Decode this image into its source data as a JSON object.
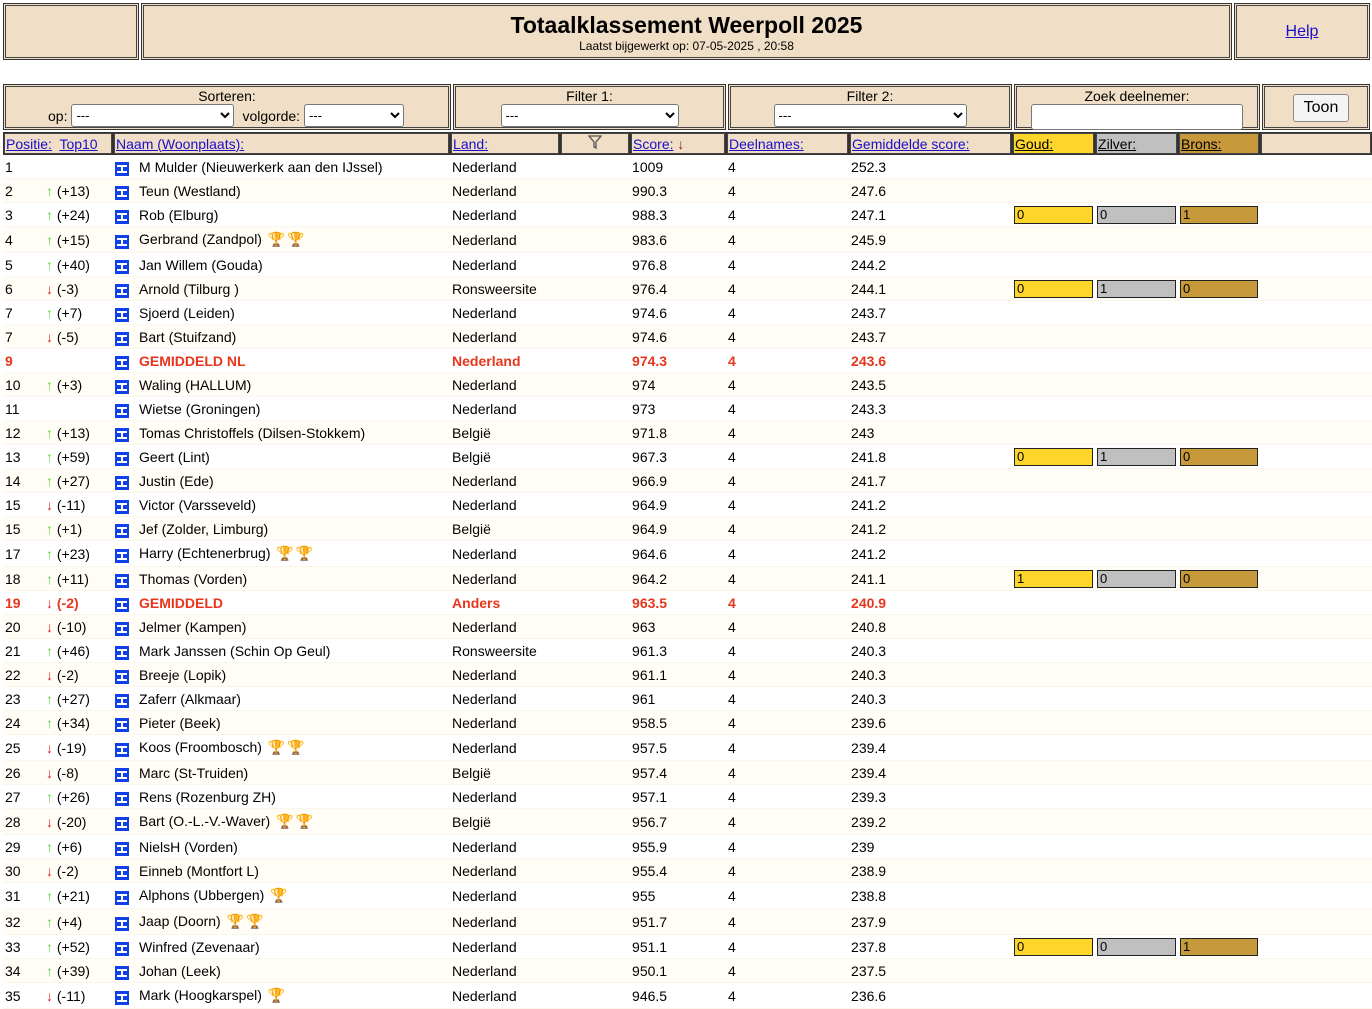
{
  "header": {
    "title": "Totaalklassement Weerpoll 2025",
    "updated": "Laatst bijgewerkt op: 07-05-2025 , 20:58",
    "help": "Help"
  },
  "controls": {
    "sort_label": "Sorteren:",
    "op_label": "op:",
    "op_value": "---",
    "order_label": "volgorde:",
    "order_value": "---",
    "filter1_label": "Filter 1:",
    "filter1_value": "---",
    "filter2_label": "Filter 2:",
    "filter2_value": "---",
    "search_label": "Zoek deelnemer:",
    "search_value": "",
    "show_button": "Toon"
  },
  "columns": {
    "position": "Positie:",
    "top10": "Top10",
    "name": "Naam (Woonplaats):",
    "land": "Land:",
    "score": "Score:",
    "entries": "Deelnames:",
    "avg": "Gemiddelde score:",
    "gold": "Goud:",
    "silver": "Zilver:",
    "bronze": "Brons:"
  },
  "colors": {
    "gold": "#fdd52b",
    "silver": "#c0c0c0",
    "bronze": "#c6993a",
    "highlight": "#e8351b",
    "header_bg": "#f0dfc6"
  },
  "rows": [
    {
      "pos": "1",
      "dir": "",
      "delta": "",
      "name": "M Mulder (Nieuwerkerk aan den IJssel)",
      "land": "Nederland",
      "score": "1009",
      "entries": "4",
      "avg": "252.3"
    },
    {
      "pos": "2",
      "dir": "up",
      "delta": "(+13)",
      "name": "Teun (Westland)",
      "land": "Nederland",
      "score": "990.3",
      "entries": "4",
      "avg": "247.6"
    },
    {
      "pos": "3",
      "dir": "up",
      "delta": "(+24)",
      "name": "Rob (Elburg)",
      "land": "Nederland",
      "score": "988.3",
      "entries": "4",
      "avg": "247.1",
      "medals": [
        "0",
        "0",
        "1"
      ]
    },
    {
      "pos": "4",
      "dir": "up",
      "delta": "(+15)",
      "name": "Gerbrand (Zandpol)",
      "land": "Nederland",
      "score": "983.6",
      "entries": "4",
      "avg": "245.9",
      "trophies": [
        "bronze",
        "bronze"
      ]
    },
    {
      "pos": "5",
      "dir": "up",
      "delta": "(+40)",
      "name": "Jan Willem (Gouda)",
      "land": "Nederland",
      "score": "976.8",
      "entries": "4",
      "avg": "244.2"
    },
    {
      "pos": "6",
      "dir": "down",
      "delta": "(-3)",
      "name": "Arnold (Tilburg )",
      "land": "Ronsweersite",
      "score": "976.4",
      "entries": "4",
      "avg": "244.1",
      "medals": [
        "0",
        "1",
        "0"
      ]
    },
    {
      "pos": "7",
      "dir": "up",
      "delta": "(+7)",
      "name": "Sjoerd (Leiden)",
      "land": "Nederland",
      "score": "974.6",
      "entries": "4",
      "avg": "243.7"
    },
    {
      "pos": "7",
      "dir": "down",
      "delta": "(-5)",
      "name": "Bart (Stuifzand)",
      "land": "Nederland",
      "score": "974.6",
      "entries": "4",
      "avg": "243.7"
    },
    {
      "pos": "9",
      "dir": "",
      "delta": "",
      "name": "GEMIDDELD NL",
      "land": "Nederland",
      "score": "974.3",
      "entries": "4",
      "avg": "243.6",
      "hl": true
    },
    {
      "pos": "10",
      "dir": "up",
      "delta": "(+3)",
      "name": "Waling (HALLUM)",
      "land": "Nederland",
      "score": "974",
      "entries": "4",
      "avg": "243.5"
    },
    {
      "pos": "11",
      "dir": "",
      "delta": "",
      "name": "Wietse (Groningen)",
      "land": "Nederland",
      "score": "973",
      "entries": "4",
      "avg": "243.3"
    },
    {
      "pos": "12",
      "dir": "up",
      "delta": "(+13)",
      "name": "Tomas Christoffels (Dilsen-Stokkem)",
      "land": "België",
      "score": "971.8",
      "entries": "4",
      "avg": "243"
    },
    {
      "pos": "13",
      "dir": "up",
      "delta": "(+59)",
      "name": "Geert (Lint)",
      "land": "België",
      "score": "967.3",
      "entries": "4",
      "avg": "241.8",
      "medals": [
        "0",
        "1",
        "0"
      ]
    },
    {
      "pos": "14",
      "dir": "up",
      "delta": "(+27)",
      "name": "Justin (Ede)",
      "land": "Nederland",
      "score": "966.9",
      "entries": "4",
      "avg": "241.7"
    },
    {
      "pos": "15",
      "dir": "down",
      "delta": "(-11)",
      "name": "Victor (Varsseveld)",
      "land": "Nederland",
      "score": "964.9",
      "entries": "4",
      "avg": "241.2"
    },
    {
      "pos": "15",
      "dir": "up",
      "delta": "(+1)",
      "name": "Jef (Zolder, Limburg)",
      "land": "België",
      "score": "964.9",
      "entries": "4",
      "avg": "241.2"
    },
    {
      "pos": "17",
      "dir": "up",
      "delta": "(+23)",
      "name": "Harry (Echtenerbrug)",
      "land": "Nederland",
      "score": "964.6",
      "entries": "4",
      "avg": "241.2",
      "trophies": [
        "gold",
        "silver"
      ]
    },
    {
      "pos": "18",
      "dir": "up",
      "delta": "(+11)",
      "name": "Thomas (Vorden)",
      "land": "Nederland",
      "score": "964.2",
      "entries": "4",
      "avg": "241.1",
      "medals": [
        "1",
        "0",
        "0"
      ]
    },
    {
      "pos": "19",
      "dir": "down",
      "delta": "(-2)",
      "name": "GEMIDDELD",
      "land": "Anders",
      "score": "963.5",
      "entries": "4",
      "avg": "240.9",
      "hl": true
    },
    {
      "pos": "20",
      "dir": "down",
      "delta": "(-10)",
      "name": "Jelmer (Kampen)",
      "land": "Nederland",
      "score": "963",
      "entries": "4",
      "avg": "240.8"
    },
    {
      "pos": "21",
      "dir": "up",
      "delta": "(+46)",
      "name": "Mark Janssen (Schin Op Geul)",
      "land": "Ronsweersite",
      "score": "961.3",
      "entries": "4",
      "avg": "240.3"
    },
    {
      "pos": "22",
      "dir": "down",
      "delta": "(-2)",
      "name": "Breeje (Lopik)",
      "land": "Nederland",
      "score": "961.1",
      "entries": "4",
      "avg": "240.3"
    },
    {
      "pos": "23",
      "dir": "up",
      "delta": "(+27)",
      "name": "Zaferr (Alkmaar)",
      "land": "Nederland",
      "score": "961",
      "entries": "4",
      "avg": "240.3"
    },
    {
      "pos": "24",
      "dir": "up",
      "delta": "(+34)",
      "name": "Pieter (Beek)",
      "land": "Nederland",
      "score": "958.5",
      "entries": "4",
      "avg": "239.6"
    },
    {
      "pos": "25",
      "dir": "down",
      "delta": "(-19)",
      "name": "Koos (Froombosch)",
      "land": "Nederland",
      "score": "957.5",
      "entries": "4",
      "avg": "239.4",
      "trophies": [
        "gold",
        "gold"
      ]
    },
    {
      "pos": "26",
      "dir": "down",
      "delta": "(-8)",
      "name": "Marc (St-Truiden)",
      "land": "België",
      "score": "957.4",
      "entries": "4",
      "avg": "239.4"
    },
    {
      "pos": "27",
      "dir": "up",
      "delta": "(+26)",
      "name": "Rens (Rozenburg ZH)",
      "land": "Nederland",
      "score": "957.1",
      "entries": "4",
      "avg": "239.3"
    },
    {
      "pos": "28",
      "dir": "down",
      "delta": "(-20)",
      "name": "Bart (O.-L.-V.-Waver)",
      "land": "België",
      "score": "956.7",
      "entries": "4",
      "avg": "239.2",
      "trophies": [
        "gold",
        "gold"
      ]
    },
    {
      "pos": "29",
      "dir": "up",
      "delta": "(+6)",
      "name": "NielsH (Vorden)",
      "land": "Nederland",
      "score": "955.9",
      "entries": "4",
      "avg": "239"
    },
    {
      "pos": "30",
      "dir": "down",
      "delta": "(-2)",
      "name": "Einneb (Montfort L)",
      "land": "Nederland",
      "score": "955.4",
      "entries": "4",
      "avg": "238.9"
    },
    {
      "pos": "31",
      "dir": "up",
      "delta": "(+21)",
      "name": "Alphons (Ubbergen)",
      "land": "Nederland",
      "score": "955",
      "entries": "4",
      "avg": "238.8",
      "trophies": [
        "bronze"
      ]
    },
    {
      "pos": "32",
      "dir": "up",
      "delta": "(+4)",
      "name": "Jaap (Doorn)",
      "land": "Nederland",
      "score": "951.7",
      "entries": "4",
      "avg": "237.9",
      "trophies": [
        "silver",
        "silver"
      ]
    },
    {
      "pos": "33",
      "dir": "up",
      "delta": "(+52)",
      "name": "Winfred (Zevenaar)",
      "land": "Nederland",
      "score": "951.1",
      "entries": "4",
      "avg": "237.8",
      "medals": [
        "0",
        "0",
        "1"
      ]
    },
    {
      "pos": "34",
      "dir": "up",
      "delta": "(+39)",
      "name": "Johan (Leek)",
      "land": "Nederland",
      "score": "950.1",
      "entries": "4",
      "avg": "237.5"
    },
    {
      "pos": "35",
      "dir": "down",
      "delta": "(-11)",
      "name": "Mark (Hoogkarspel)",
      "land": "Nederland",
      "score": "946.5",
      "entries": "4",
      "avg": "236.6",
      "trophies": [
        "silver"
      ]
    }
  ]
}
